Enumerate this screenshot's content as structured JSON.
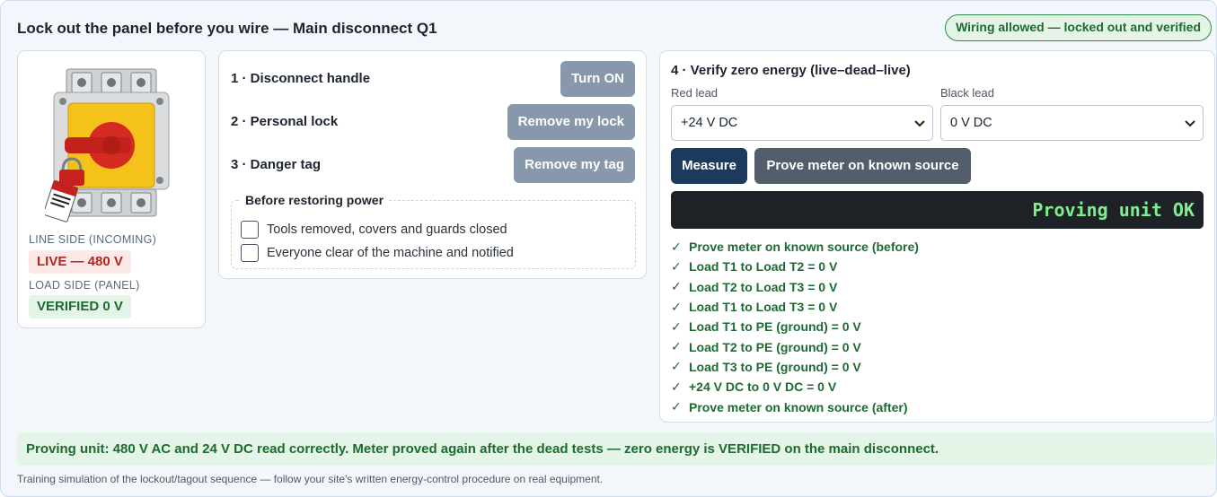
{
  "title": "Lock out the panel before you wire — Main disconnect Q1",
  "status_pill": "Wiring allowed — locked out and verified",
  "left_panel": {
    "image": {
      "name": "disconnect-switch-with-lock-and-tag",
      "tag_text": "DANGER DO NOT OPERATE"
    },
    "line_side_label": "LINE SIDE (INCOMING)",
    "line_side_value": "LIVE — 480 V",
    "load_side_label": "LOAD SIDE (PANEL)",
    "load_side_value": "VERIFIED 0 V"
  },
  "steps": {
    "handle": {
      "label": "1 · Disconnect handle",
      "button": "Turn ON"
    },
    "lock": {
      "label": "2 · Personal lock",
      "button": "Remove my lock"
    },
    "tag": {
      "label": "3 · Danger tag",
      "button": "Remove my tag"
    }
  },
  "restore": {
    "legend": "Before restoring power",
    "items": [
      "Tools removed, covers and guards closed",
      "Everyone clear of the machine and notified"
    ]
  },
  "verify": {
    "title": "4 · Verify zero energy (live–dead–live)",
    "red_lead_label": "Red lead",
    "red_lead_value": "+24 V DC",
    "black_lead_label": "Black lead",
    "black_lead_value": "0 V DC",
    "measure_button": "Measure",
    "prove_button": "Prove meter on known source",
    "display": "Proving unit OK",
    "results": [
      "Prove meter on known source (before)",
      "Load T1 to Load T2 = 0 V",
      "Load T2 to Load T3 = 0 V",
      "Load T1 to Load T3 = 0 V",
      "Load T1 to PE (ground) = 0 V",
      "Load T2 to PE (ground) = 0 V",
      "Load T3 to PE (ground) = 0 V",
      "+24 V DC to 0 V DC = 0 V",
      "Prove meter on known source (after)"
    ]
  },
  "summary": "Proving unit: 480 V AC and 24 V DC read correctly. Meter proved again after the dead tests — zero energy is VERIFIED on the main disconnect.",
  "footnote": "Training simulation of the lockout/tagout sequence — follow your site's written energy-control procedure on real equipment.",
  "colors": {
    "live": "#b3261e",
    "verified": "#1d6a32",
    "accent": "#1c3a5c",
    "display_text": "#7df08d"
  }
}
